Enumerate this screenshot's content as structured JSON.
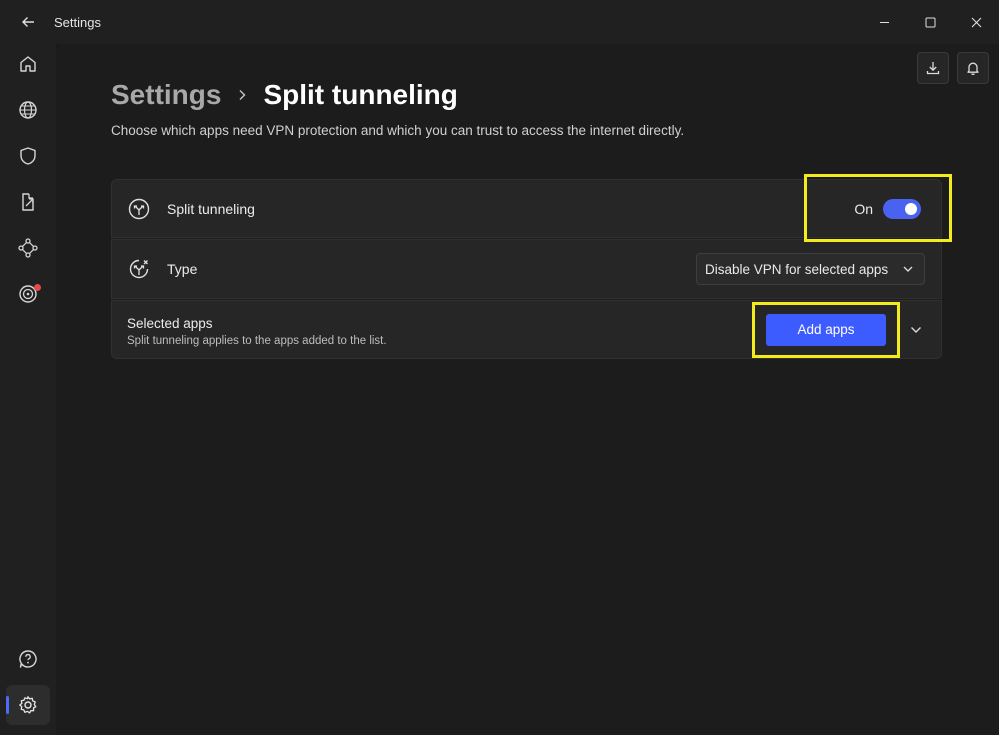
{
  "window": {
    "title": "Settings"
  },
  "breadcrumb": {
    "parent": "Settings",
    "current": "Split tunneling"
  },
  "subtitle": "Choose which apps need VPN protection and which you can trust to access the internet directly.",
  "split_tunneling": {
    "label": "Split tunneling",
    "state_text": "On",
    "enabled": true
  },
  "type": {
    "label": "Type",
    "selected": "Disable VPN for selected apps"
  },
  "selected_apps": {
    "title": "Selected apps",
    "description": "Split tunneling applies to the apps added to the list.",
    "add_button": "Add apps"
  },
  "colors": {
    "accent": "#3d5cff",
    "toggle": "#4a62f0",
    "highlight": "#f4ec1a",
    "notification": "#e54b4b"
  },
  "icons": {
    "sidebar": [
      "home-icon",
      "globe-icon",
      "shield-icon",
      "file-export-icon",
      "mesh-network-icon",
      "target-icon",
      "help-icon",
      "settings-gear-icon"
    ],
    "top_actions": [
      "download-icon",
      "bell-icon"
    ]
  }
}
